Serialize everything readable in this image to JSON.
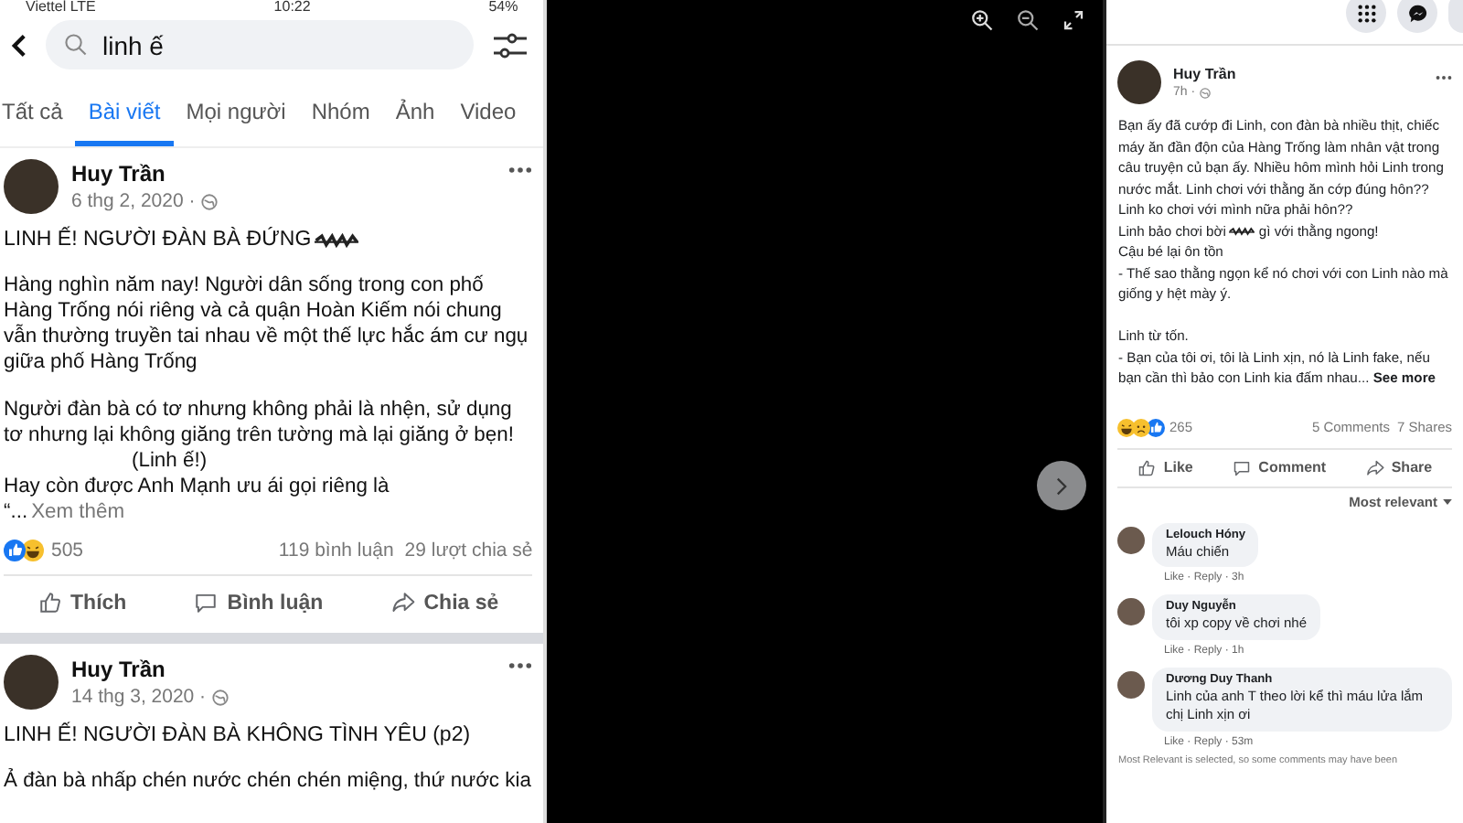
{
  "status_bar": {
    "carrier": "Viettel LTE",
    "time": "10:22",
    "battery": "54%"
  },
  "search": {
    "value": "linh ế"
  },
  "tabs": [
    {
      "label": "Tất cả",
      "selected": false
    },
    {
      "label": "Bài viết",
      "selected": true
    },
    {
      "label": "Mọi người",
      "selected": false
    },
    {
      "label": "Nhóm",
      "selected": false
    },
    {
      "label": "Ảnh",
      "selected": false
    },
    {
      "label": "Video",
      "selected": false
    }
  ],
  "results": [
    {
      "author": "Huy Trần",
      "date": "6 thg 2, 2020 ·",
      "title": "LINH Ế! NGƯỜI ĐÀN BÀ ĐỨNG",
      "redacted": true,
      "paragraphs": [
        "Hàng nghìn năm nay! Người dân sống trong con phố Hàng Trống nói riêng và cả quận Hoàn Kiếm  nói chung vẫn thường truyền tai nhau về một thế lực hắc ám cư ngụ giữa phố Hàng Trống",
        "Người đàn bà có tơ nhưng không phải là nhện, sử dụng tơ nhưng lại không giăng trên tường mà lại giăng ở bẹn!"
      ],
      "aside": "(Linh ế!)",
      "tail": "Hay còn được Anh Mạnh ưu ái gọi riêng là",
      "more_prefix": "“...",
      "more": "Xem thêm",
      "reactions": [
        {
          "kind": "like"
        },
        {
          "kind": "haha"
        }
      ],
      "reaction_count": "505",
      "comments": "119 bình luận",
      "shares": "29 lượt chia sẻ",
      "actions": [
        "Thích",
        "Bình luận",
        "Chia sẻ"
      ]
    },
    {
      "author": "Huy Trần",
      "date": "14 thg 3, 2020 ·",
      "title": "LINH Ế! NGƯỜI ĐÀN BÀ KHÔNG TÌNH YÊU (p2)",
      "redacted": false,
      "paragraphs": [
        "Ả đàn bà nhấp chén nước chén chén miệng, thứ nước kia"
      ]
    }
  ],
  "post": {
    "author": "Huy Trần",
    "time": "7h ·",
    "lines": [
      {
        "kind": "text",
        "text": "Bạn ấy đã cướp đi Linh, con đàn bà nhiều thịt, chiếc máy ăn đần độn của Hàng Trống làm nhân vật trong câu truyện củ bạn ấy. Nhiều hôm mình hỏi Linh trong nước mắt. Linh chơi với thằng ăn cớp đúng hôn?? Linh ko chơi với mình nữa phải hôn??"
      },
      {
        "kind": "redacted",
        "before": "Linh bảo chơi bời",
        "after": "gì với thằng ngong!"
      },
      {
        "kind": "text",
        "text": "Cậu bé lại ôn tồn"
      },
      {
        "kind": "text",
        "text": "- Thế sao thằng ngọn kể nó chơi với con Linh nào mà giống y hệt mày ý."
      },
      {
        "kind": "gap"
      },
      {
        "kind": "text",
        "text": "Linh từ tốn."
      },
      {
        "kind": "more",
        "text": "- Bạn của tôi ơi, tôi là Linh xịn, nó là Linh fake, nếu bạn cần thì bảo con Linh kia đấm nhau...",
        "more": "See more"
      }
    ],
    "reactions": [
      {
        "kind": "haha"
      },
      {
        "kind": "sad"
      },
      {
        "kind": "like"
      }
    ],
    "reaction_count": "265",
    "comments": "5 Comments",
    "shares": "7 Shares",
    "actions": [
      "Like",
      "Comment",
      "Share"
    ],
    "sort": "Most relevant",
    "comment_list": [
      {
        "name": "Lelouch Hóny",
        "text": "Máu chiến",
        "meta": "Like · Reply · 3h"
      },
      {
        "name": "Duy Nguyễn",
        "text": "tôi xp copy về chơi nhé",
        "meta": "Like · Reply · 1h"
      },
      {
        "name": "Dương Duy Thanh",
        "text": "Linh của anh T theo lời kể thì máu lửa lắm chị Linh xịn ơi",
        "meta": "Like · Reply · 53m"
      }
    ],
    "footer": "Most Relevant is selected, so some comments may have been"
  }
}
